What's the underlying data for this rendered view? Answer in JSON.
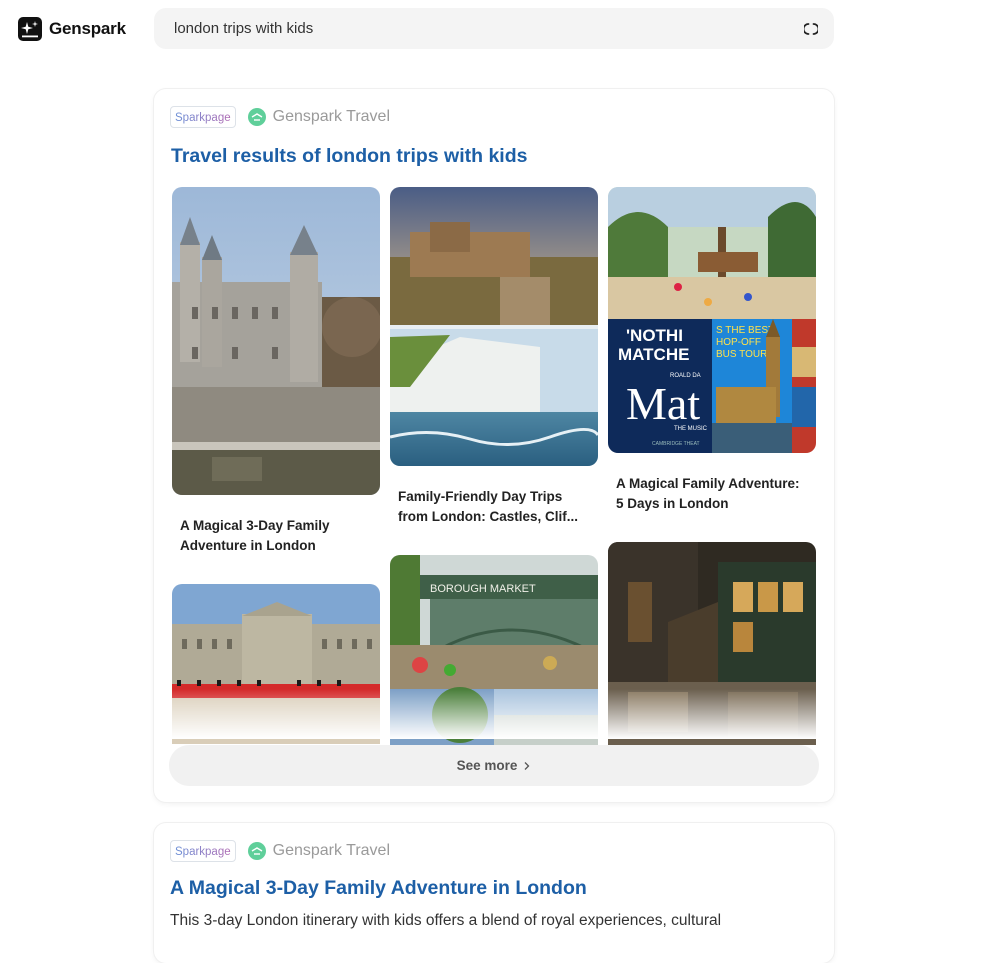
{
  "brand": {
    "name": "Genspark",
    "icon": "genspark-logo-icon"
  },
  "search": {
    "query": "london trips with kids",
    "status_icon": "loading-spinner-icon"
  },
  "result_card": {
    "badge": "Sparkpage",
    "source_name": "Genspark Travel",
    "source_icon": "genspark-travel-icon",
    "title": "Travel results of london trips with kids",
    "items": [
      {
        "caption_line1": "A Magical 3-Day Family",
        "caption_line2": "Adventure in London",
        "image": "tower-of-london-photo"
      },
      {
        "caption_line1": "Family-Friendly Day Trips",
        "caption_line2": "from London: Castles, Clif...",
        "image": "dover-castle-and-white-cliffs-photo"
      },
      {
        "caption_line1": "A Magical Family Adventure:",
        "caption_line2": "5 Days in London",
        "image": "playground-matilda-big-ben-collage"
      },
      {
        "image": "buckingham-palace-guards-photo"
      },
      {
        "image": "borough-market-photo",
        "sign_text": "BOROUGH MARKET"
      },
      {
        "image": "old-victorian-street-photo"
      }
    ],
    "poster_text": {
      "line1": "'NOTHI",
      "line2": "MATCHE",
      "big": "Mat",
      "sub": "THE MUSIC",
      "small": "ROALD DA",
      "footer": "CAMBRIDGE THEAT"
    },
    "bus_text": {
      "line1": "S THE BEST",
      "line2": "HOP-OFF",
      "line3": "BUS TOUR?"
    },
    "see_more": "See more"
  },
  "second_card": {
    "badge": "Sparkpage",
    "source_name": "Genspark Travel",
    "title": "A Magical 3-Day Family Adventure in London",
    "description": "This 3-day London itinerary with kids offers a blend of royal experiences, cultural"
  },
  "colors": {
    "link_blue": "#1d5fa6",
    "muted_gray": "#9a9a9a",
    "pill_gray": "#f1f1f1",
    "brand_green": "#5fcf9a"
  }
}
